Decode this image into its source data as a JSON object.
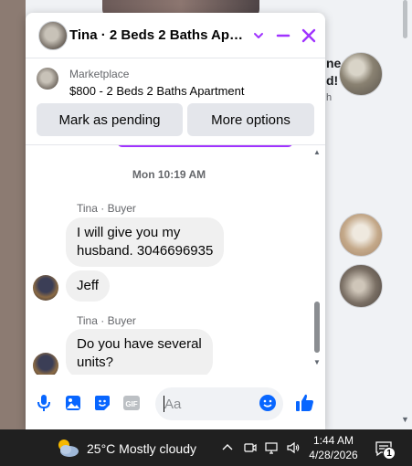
{
  "chat": {
    "title": "Tina · 2 Beds 2 Baths Apar…",
    "marketplace_label": "Marketplace",
    "listing_title": "$800 - 2 Beds 2 Baths Apartment",
    "buttons": {
      "mark_pending": "Mark as pending",
      "more_options": "More options"
    },
    "timestamp": "Mon 10:19 AM",
    "messages": [
      {
        "sender": "Tina · Buyer",
        "lines": [
          "I will give you my",
          "husband.  3046696935"
        ]
      },
      {
        "text": "Jeff"
      },
      {
        "sender": "Tina · Buyer",
        "lines": [
          "Do you have several",
          "units?"
        ]
      }
    ],
    "input_placeholder": "Aa"
  },
  "background": {
    "snippet_line1": "ne",
    "snippet_line2": "d!",
    "snippet_line3": "h"
  },
  "taskbar": {
    "weather": "25°C  Mostly cloudy",
    "time": "1:44 AM",
    "date": "4/28/2026",
    "notification_count": "1"
  },
  "colors": {
    "accent": "#a033ff",
    "messenger_blue": "#0866ff",
    "taskbar": "#202020",
    "bubble": "#f0f0f0"
  },
  "icons": [
    "chevron-down-icon",
    "minimize-icon",
    "close-icon",
    "microphone-icon",
    "image-icon",
    "sticker-icon",
    "gif-icon",
    "emoji-icon",
    "thumbs-up-icon",
    "weather-cloud-icon",
    "chevron-up-icon",
    "meet-now-icon",
    "network-icon",
    "volume-icon",
    "notification-icon"
  ]
}
